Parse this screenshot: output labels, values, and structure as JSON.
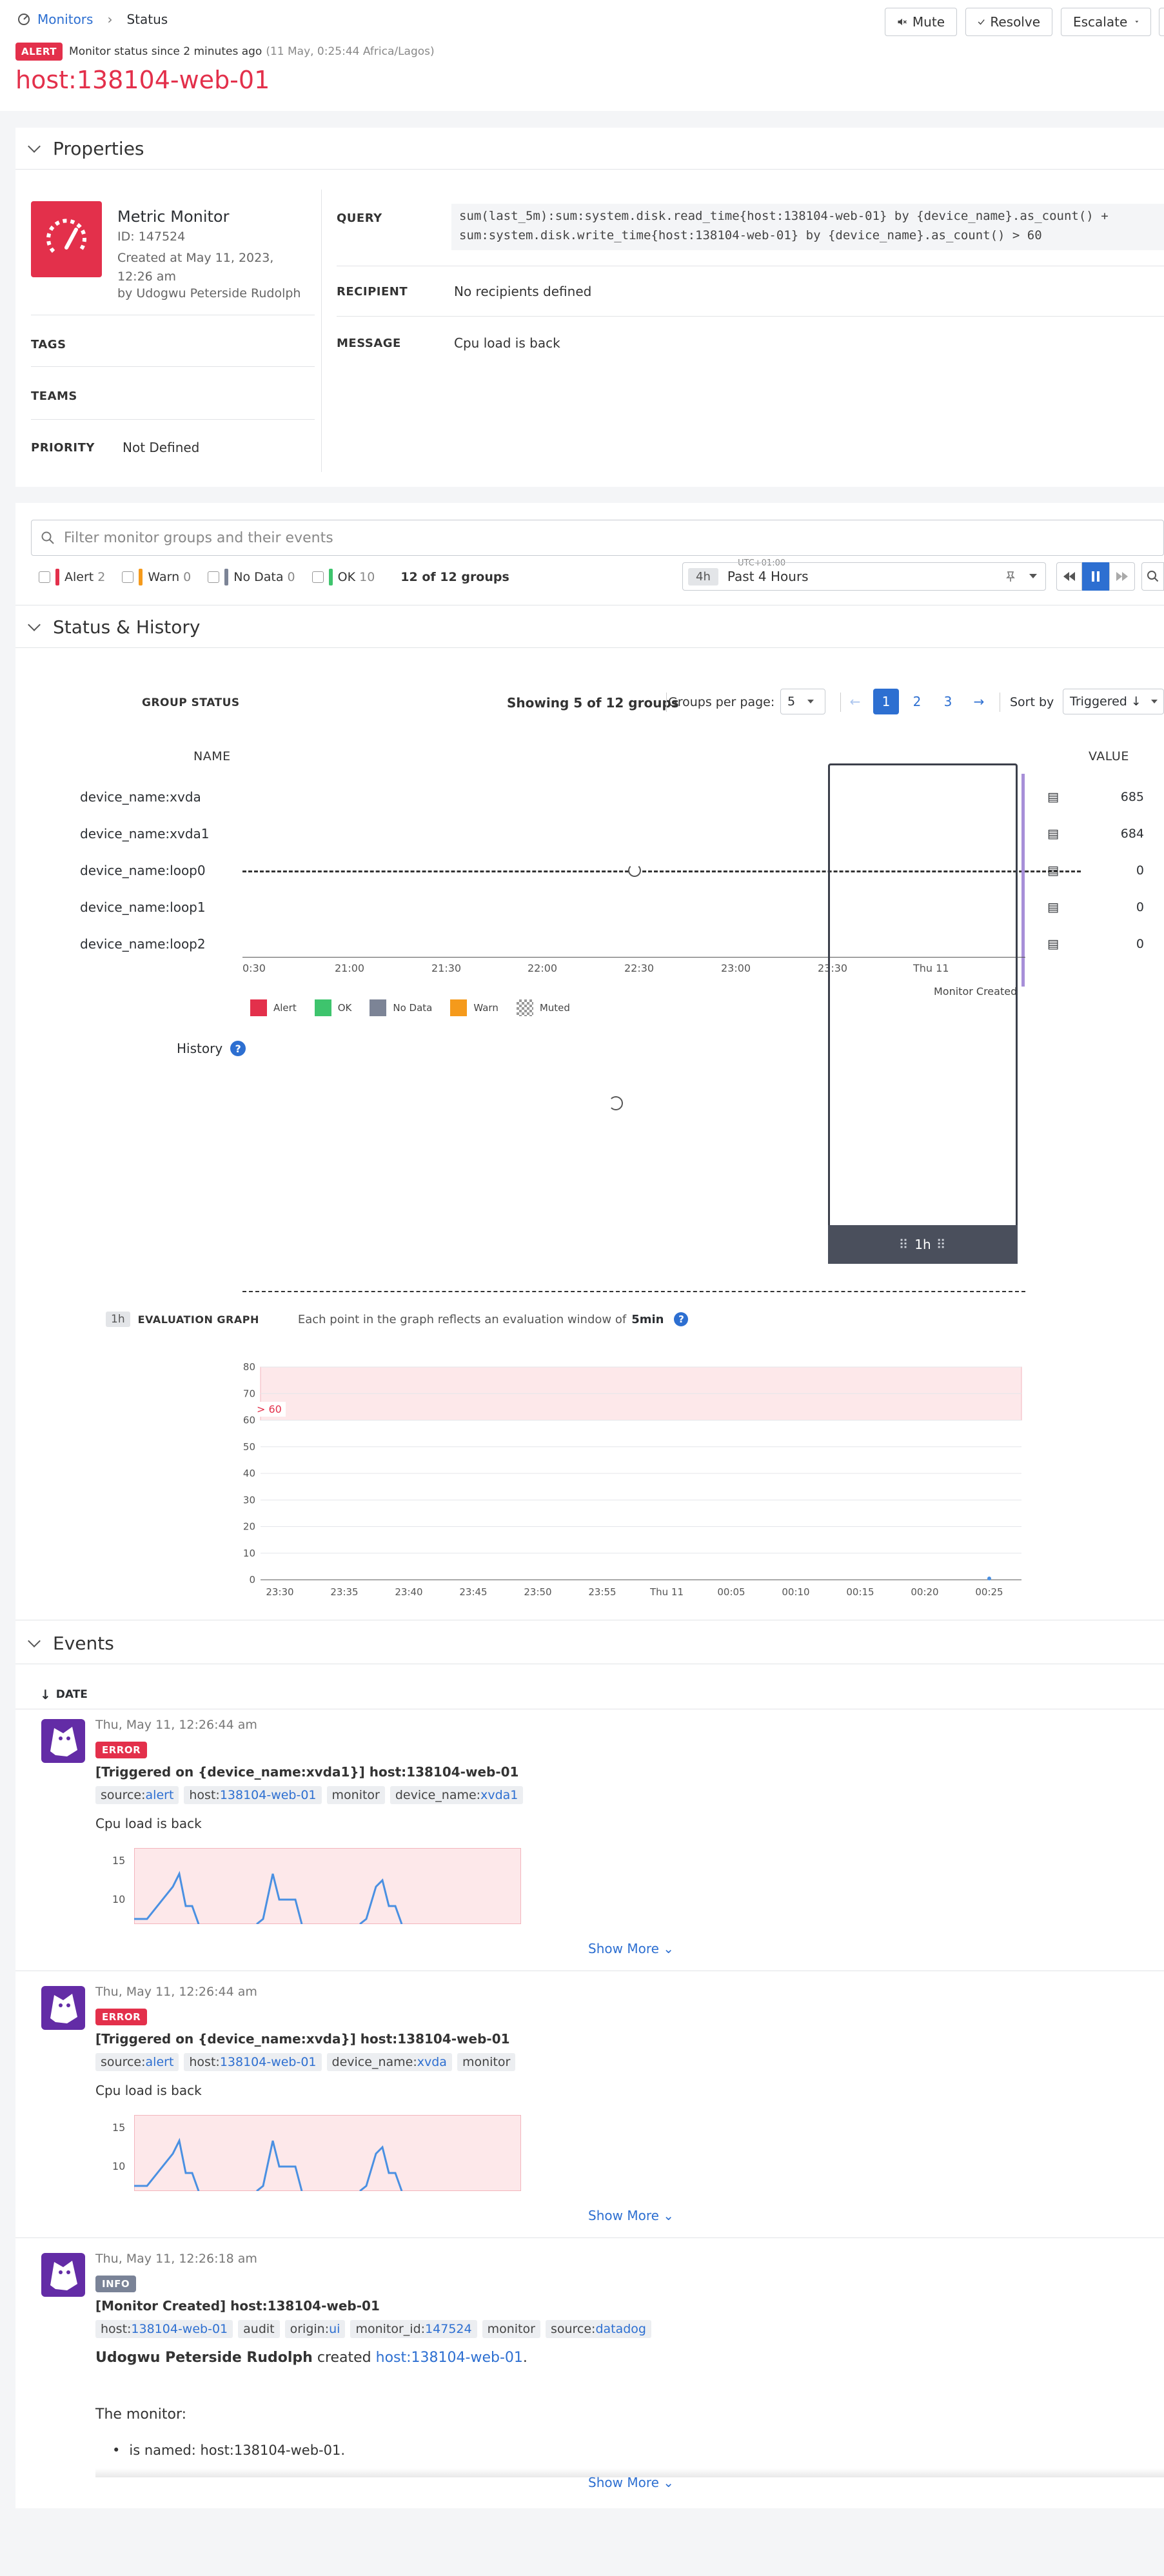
{
  "breadcrumb": {
    "root": "Monitors",
    "current": "Status"
  },
  "alert_bar": {
    "badge": "ALERT",
    "status_text": "Monitor status since 2 minutes ago",
    "timestamp": "(11 May, 0:25:44 Africa/Lagos)"
  },
  "monitor_title": "host:138104-web-01",
  "header_buttons": {
    "mute": "Mute",
    "resolve": "Resolve",
    "escalate": "Escalate"
  },
  "properties": {
    "section_title": "Properties",
    "type": "Metric Monitor",
    "id": "ID: 147524",
    "created_at": "Created at May 11, 2023, 12:26 am",
    "created_by": "by Udogwu Peterside Rudolph",
    "tags_label": "TAGS",
    "teams_label": "TEAMS",
    "priority_label": "PRIORITY",
    "priority_value": "Not Defined",
    "query_label": "QUERY",
    "query_line1": "sum(last_5m):sum:system.disk.read_time{host:138104-web-01} by {device_name}.as_count() +",
    "query_line2": "sum:system.disk.write_time{host:138104-web-01} by {device_name}.as_count() > 60",
    "recipient_label": "RECIPIENT",
    "recipient_value": "No recipients defined",
    "message_label": "MESSAGE",
    "message_value": "Cpu load is back"
  },
  "filter": {
    "placeholder": "Filter monitor groups and their events",
    "alert_label": "Alert",
    "alert_count": "2",
    "warn_label": "Warn",
    "warn_count": "0",
    "nodata_label": "No Data",
    "nodata_count": "0",
    "ok_label": "OK",
    "ok_count": "10",
    "groups_summary": "12 of 12 groups",
    "timezone": "UTC+01:00",
    "time_badge": "4h",
    "time_range": "Past 4 Hours"
  },
  "status_history": {
    "section_title": "Status & History",
    "group_status_label": "GROUP STATUS",
    "showing": "Showing 5 of 12 groups",
    "groups_per_page_label": "Groups per page:",
    "groups_per_page_value": "5",
    "pages": [
      "1",
      "2",
      "3"
    ],
    "sort_label": "Sort by",
    "sort_value": "Triggered ↓",
    "name_header": "NAME",
    "value_header": "VALUE",
    "rows": [
      {
        "name": "device_name:xvda",
        "value": "685"
      },
      {
        "name": "device_name:xvda1",
        "value": "684"
      },
      {
        "name": "device_name:loop0",
        "value": "0"
      },
      {
        "name": "device_name:loop1",
        "value": "0"
      },
      {
        "name": "device_name:loop2",
        "value": "0"
      }
    ],
    "time_ticks": [
      "0:30",
      "21:00",
      "21:30",
      "22:00",
      "22:30",
      "23:00",
      "23:30",
      "Thu 11"
    ],
    "monitor_created": "Monitor Created",
    "legend": [
      {
        "label": "Alert",
        "color": "#e3304b"
      },
      {
        "label": "OK",
        "color": "#3ec46d"
      },
      {
        "label": "No Data",
        "color": "#7c8496"
      },
      {
        "label": "Warn",
        "color": "#f59a1b"
      },
      {
        "label": "Muted",
        "color": "#bbbbbb"
      }
    ],
    "history_label": "History",
    "window_label": "1h"
  },
  "evaluation": {
    "badge": "1h",
    "label": "EVALUATION GRAPH",
    "desc": "Each point in the graph reflects an evaluation window of",
    "window": "5min",
    "threshold_label": "> 60"
  },
  "chart_data": {
    "type": "line",
    "title": "",
    "xlabel": "",
    "ylabel": "",
    "ylim": [
      0,
      80
    ],
    "yticks": [
      0,
      10,
      20,
      30,
      40,
      50,
      60,
      70,
      80
    ],
    "x": [
      "23:30",
      "23:35",
      "23:40",
      "23:45",
      "23:50",
      "23:55",
      "Thu 11",
      "00:05",
      "00:10",
      "00:15",
      "00:20",
      "00:25"
    ],
    "threshold": 60,
    "series": [
      {
        "values": [
          null,
          null,
          null,
          null,
          null,
          null,
          null,
          null,
          null,
          null,
          null,
          0.5
        ]
      }
    ]
  },
  "events": {
    "section_title": "Events",
    "date_header": "DATE",
    "show_more": "Show More",
    "items": [
      {
        "time": "Thu, May 11, 12:26:44 am",
        "badge": "ERROR",
        "title": "[Triggered on {device_name:xvda1}] host:138104-web-01",
        "tags": [
          [
            "source",
            "alert"
          ],
          [
            "host",
            "138104-web-01"
          ],
          [
            "monitor",
            ""
          ],
          [
            "device_name",
            "xvda1"
          ]
        ],
        "message": "Cpu load is back",
        "ticks": [
          "15",
          "10"
        ]
      },
      {
        "time": "Thu, May 11, 12:26:44 am",
        "badge": "ERROR",
        "title": "[Triggered on {device_name:xvda}] host:138104-web-01",
        "tags": [
          [
            "source",
            "alert"
          ],
          [
            "host",
            "138104-web-01"
          ],
          [
            "device_name",
            "xvda"
          ],
          [
            "monitor",
            ""
          ]
        ],
        "message": "Cpu load is back",
        "ticks": [
          "15",
          "10"
        ]
      },
      {
        "time": "Thu, May 11, 12:26:18 am",
        "badge": "INFO",
        "title": "[Monitor Created] host:138104-web-01",
        "tags": [
          [
            "host",
            "138104-web-01"
          ],
          [
            "audit",
            ""
          ],
          [
            "origin",
            "ui"
          ],
          [
            "monitor_id",
            "147524"
          ],
          [
            "monitor",
            ""
          ],
          [
            "source",
            "datadog"
          ]
        ],
        "creator": "Udogwu Peterside Rudolph",
        "created_word": "created",
        "created_link": "host:138104-web-01",
        "the_monitor": "The monitor:",
        "bullet": "is named: host:138104-web-01."
      }
    ]
  }
}
